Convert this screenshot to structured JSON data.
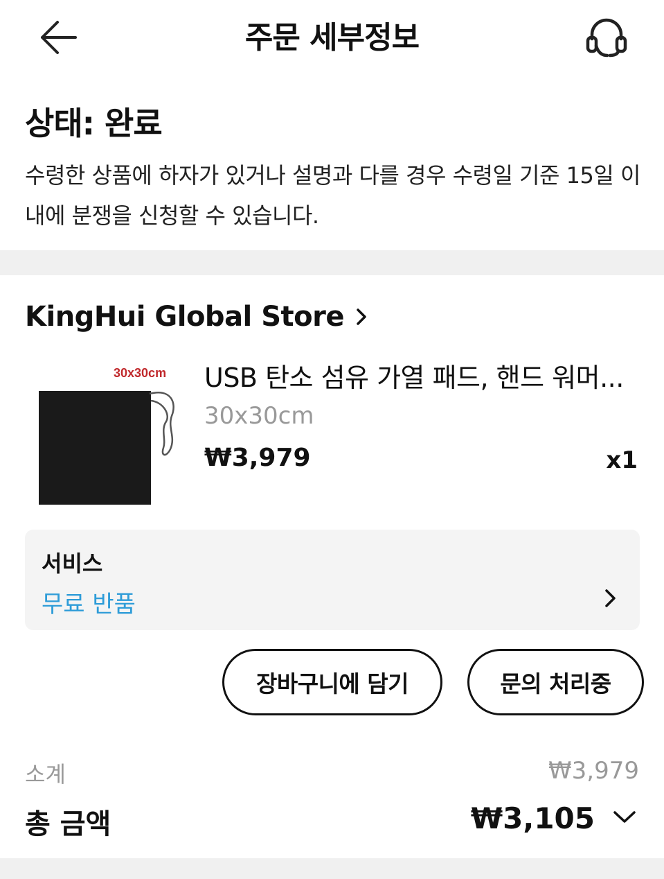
{
  "header": {
    "title": "주문 세부정보",
    "back_icon": "arrow-left-icon",
    "support_icon": "headset-icon"
  },
  "status": {
    "title": "상태: 완료",
    "description": "수령한 상품에 하자가 있거나 설명과 다를 경우 수령일 기준 15일 이내에 분쟁을 신청할 수 있습니다."
  },
  "store": {
    "name": "KingHui Global Store"
  },
  "product": {
    "image_tag": "30x30cm",
    "title": "USB 탄소 섬유 가열 패드, 핸드 워머...",
    "variant": "30x30cm",
    "price": "₩3,979",
    "quantity": "x1"
  },
  "service": {
    "label": "서비스",
    "value": "무료 반품",
    "value_color": "#2e9cd8"
  },
  "actions": {
    "add_to_cart": "장바구니에 담기",
    "inquiry": "문의 처리중"
  },
  "summary": {
    "subtotal_label": "소계",
    "subtotal_value": "₩3,979",
    "total_label": "총 금액",
    "total_value": "₩3,105"
  }
}
